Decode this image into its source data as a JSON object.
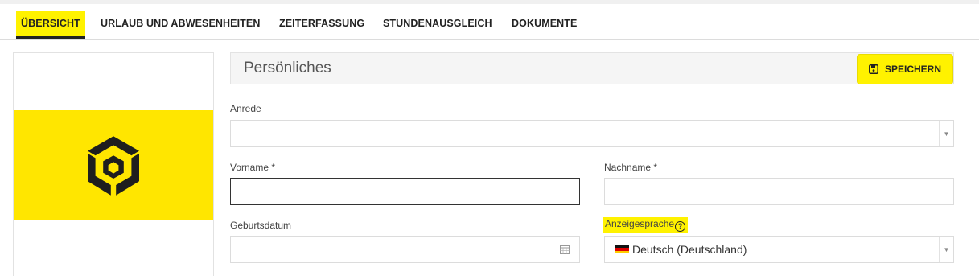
{
  "tabs": [
    {
      "label": "ÜBERSICHT",
      "active": true
    },
    {
      "label": "URLAUB UND ABWESENHEITEN"
    },
    {
      "label": "ZEITERFASSUNG"
    },
    {
      "label": "STUNDENAUSGLEICH"
    },
    {
      "label": "DOKUMENTE"
    }
  ],
  "section": {
    "title": "Persönliches",
    "save_label": "SPEICHERN"
  },
  "form": {
    "anrede": {
      "label": "Anrede",
      "value": ""
    },
    "vorname": {
      "label": "Vorname *",
      "value": ""
    },
    "nachname": {
      "label": "Nachname *",
      "value": ""
    },
    "geburtsdatum": {
      "label": "Geburtsdatum",
      "value": ""
    },
    "anzeigesprache": {
      "label": "Anzeigesprache",
      "value": "Deutsch (Deutschland)"
    }
  },
  "icons": {
    "logo": "hexagon-cube-logo",
    "save": "floppy-disk-icon",
    "calendar": "calendar-icon",
    "help": "question-circle-icon",
    "flag": "germany-flag-icon"
  },
  "colors": {
    "accent": "#fff200",
    "logo_bg": "#ffe600"
  }
}
